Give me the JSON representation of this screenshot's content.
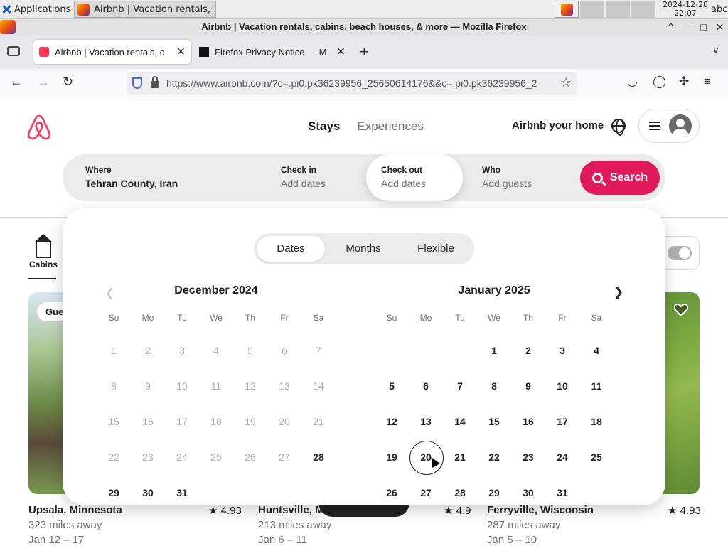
{
  "taskbar": {
    "apps_label": "Applications",
    "window_title": "Airbnb | Vacation rentals, ...",
    "clock_date": "2024-12-28",
    "clock_time": "22:07",
    "kbd": "abc"
  },
  "browser": {
    "window_title": "Airbnb | Vacation rentals, cabins, beach houses, & more — Mozilla Firefox",
    "tabs": [
      {
        "title": "Airbnb | Vacation rentals, c",
        "close": "✕"
      },
      {
        "title": "Firefox Privacy Notice — M",
        "close": "✕"
      }
    ],
    "new_tab": "+",
    "url": "https://www.airbnb.com/?c=.pi0.pk36239956_25650614176&&c=.pi0.pk36239956_2",
    "url_domain": "airbnb.com"
  },
  "header": {
    "tabs": {
      "stays": "Stays",
      "experiences": "Experiences"
    },
    "host_link": "Airbnb your home"
  },
  "search": {
    "where": {
      "label": "Where",
      "value": "Tehran County, Iran"
    },
    "checkin": {
      "label": "Check in",
      "value": "Add dates"
    },
    "checkout": {
      "label": "Check out",
      "value": "Add dates"
    },
    "who": {
      "label": "Who",
      "value": "Add guests"
    },
    "button": "Search"
  },
  "picker": {
    "modes": {
      "dates": "Dates",
      "months": "Months",
      "flexible": "Flexible"
    },
    "selected_mode": "Dates",
    "weekdays": [
      "Su",
      "Mo",
      "Tu",
      "We",
      "Th",
      "Fr",
      "Sa"
    ],
    "months": [
      {
        "title": "December 2024",
        "leading_blanks": 0,
        "days": 31,
        "disabled_through": 27
      },
      {
        "title": "January 2025",
        "leading_blanks": 3,
        "days": 31,
        "disabled_through": 0,
        "hovered": 20
      }
    ]
  },
  "category": {
    "label": "Cabins"
  },
  "listings": [
    {
      "title": "Upsala, Minnesota",
      "rating": "4.93",
      "distance": "323 miles away",
      "dates": "Jan 12 – 17",
      "badge": "Guest favorite"
    },
    {
      "title": "Huntsville, M",
      "rating": "4.9",
      "distance": "213 miles away",
      "dates": "Jan 6 – 11"
    },
    {
      "title": "Ferryville, Wisconsin",
      "rating": "4.93",
      "distance": "287 miles away",
      "dates": "Jan 5 – 10"
    }
  ],
  "colors": {
    "brand": "#ff385c",
    "search_button": "#e01a5b",
    "text": "#222222",
    "muted": "#717171",
    "disabled": "#b0b0b0"
  },
  "icons": [
    "airbnb-logo-icon",
    "globe-icon",
    "hamburger-icon",
    "avatar-icon",
    "search-icon",
    "cabin-icon",
    "chevron-left-icon",
    "chevron-right-icon",
    "heart-icon",
    "star-icon"
  ]
}
